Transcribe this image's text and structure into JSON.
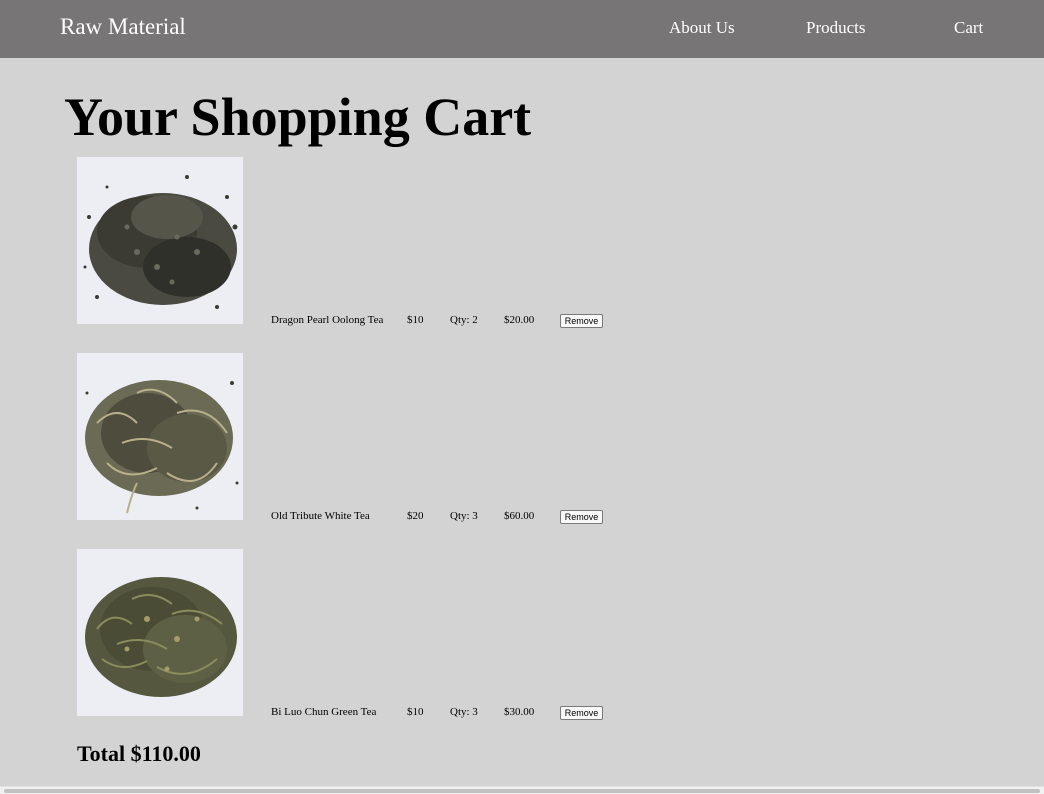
{
  "navbar": {
    "brand": "Raw Material",
    "links": [
      "About Us",
      "Products",
      "Cart"
    ]
  },
  "page": {
    "title": "Your Shopping Cart"
  },
  "cart": {
    "items": [
      {
        "name": "Dragon Pearl Oolong Tea",
        "price": "$10",
        "qty": "Qty: 2",
        "subtotal": "$20.00",
        "remove_label": "Remove",
        "image_icon": "tea-leaves-photo"
      },
      {
        "name": "Old Tribute White Tea",
        "price": "$20",
        "qty": "Qty: 3",
        "subtotal": "$60.00",
        "remove_label": "Remove",
        "image_icon": "tea-leaves-photo"
      },
      {
        "name": "Bi Luo Chun Green Tea",
        "price": "$10",
        "qty": "Qty: 3",
        "subtotal": "$30.00",
        "remove_label": "Remove",
        "image_icon": "tea-leaves-photo"
      }
    ],
    "total": "Total $110.00"
  },
  "colors": {
    "navbar_bg": "#777576",
    "page_bg": "#d3d3d3",
    "nav_text": "#ffffff"
  }
}
